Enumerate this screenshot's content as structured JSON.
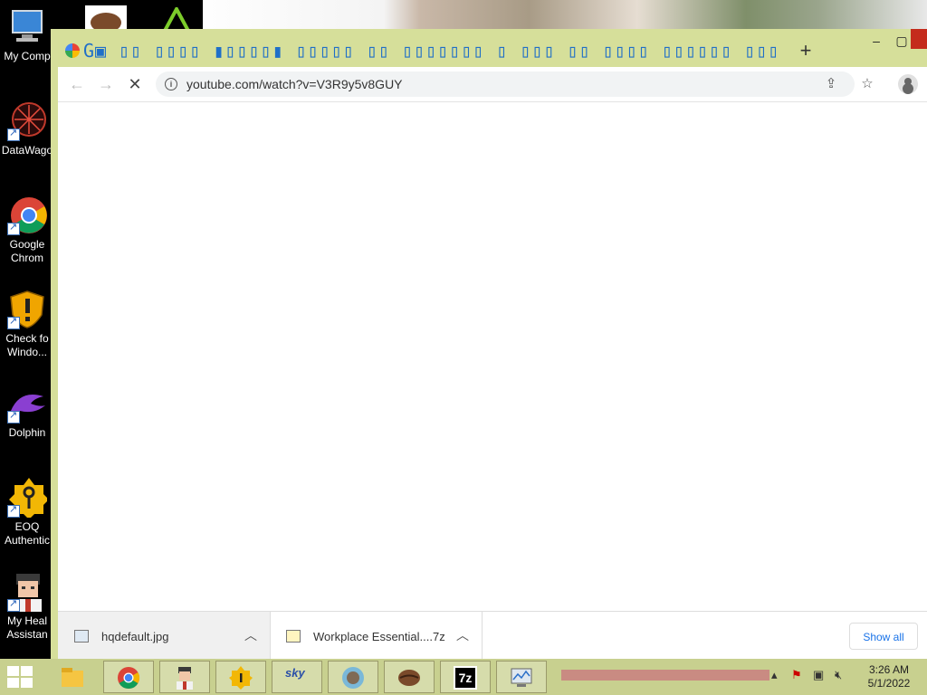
{
  "desktop": {
    "icons": [
      {
        "label_line1": "My Comp",
        "label_line2": ""
      },
      {
        "label_line1": "DataWago",
        "label_line2": ""
      },
      {
        "label_line1": "Google",
        "label_line2": "Chrom"
      },
      {
        "label_line1": "Check fo",
        "label_line2": "Windo..."
      },
      {
        "label_line1": "Dolphin",
        "label_line2": ""
      },
      {
        "label_line1": "EOQ",
        "label_line2": "Authentic"
      },
      {
        "label_line1": "My Heal",
        "label_line2": "Assistan"
      }
    ]
  },
  "browser": {
    "tab_title": "G▣ ▯▯ ▯▯▯▯ ▮▯▯▯▯▮ ▯▯▯▯▯ ▯▯ ▯▯▯▯▯▯▯ ▯ ▯▯▯ ▯▯ ▯▯▯▯ ▯▯▯▯▯▯ ▯▯▯▯▯▯ ▯ ▯▯",
    "new_tab": "+",
    "url": "youtube.com/watch?v=V3R9y5v8GUY",
    "downloads": [
      {
        "name": "hqdefault.jpg"
      },
      {
        "name": "Workplace Essential....7z"
      }
    ],
    "show_all": "Show all"
  },
  "taskbar": {
    "time": "3:26 AM",
    "date": "5/1/2022"
  },
  "colors": {
    "window_frame": "#d6df9a",
    "taskbar": "#c8d08f",
    "link_blue": "#1a73e8"
  }
}
